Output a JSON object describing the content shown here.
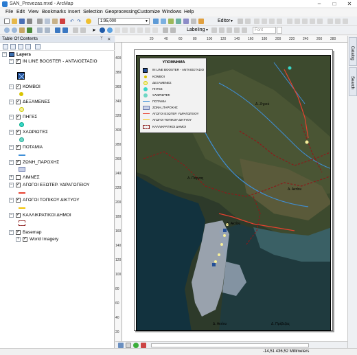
{
  "window": {
    "title": "SAN_Prevezas.mxd - ArcMap"
  },
  "menu": [
    "File",
    "Edit",
    "View",
    "Bookmarks",
    "Insert",
    "Selection",
    "Geoprocessing",
    "Customize",
    "Windows",
    "Help"
  ],
  "toolbar": {
    "scale": "1:95,000",
    "editor_label": "Editor",
    "labeling_label": "Labeling",
    "font_name": "Font"
  },
  "toc": {
    "title": "Table Of Contents",
    "root": "Layers",
    "layers": [
      {
        "label": "IN LINE BOOSTER - ΑΝΤΛΙΟΣΤΑΣΙΟ",
        "checked": true
      },
      {
        "label": "ΚΟΜΒΟΙ",
        "checked": true
      },
      {
        "label": "ΔΕΞΑΜΕΝΕΣ",
        "checked": true
      },
      {
        "label": "ΠΗΓΕΣ",
        "checked": true
      },
      {
        "label": "ΧΛΩΡΙΩΤΕΣ",
        "checked": true
      },
      {
        "label": "ΠΟΤΑΜΙΑ",
        "checked": true
      },
      {
        "label": "ΖΩΝΗ_ΠΑΡΟΧΗΣ",
        "checked": true
      },
      {
        "label": "ΛΙΜΝΕΣ",
        "checked": false
      },
      {
        "label": "ΑΓΩΓΟΙ ΕΞΩΤΕΡ. ΥΔΡΑΓΩΓΕΙΟΥ",
        "checked": true
      },
      {
        "label": "ΑΓΩΓΟΙ ΤΟΠΙΚΟΥ ΔΙΚΤΥΟΥ",
        "checked": true
      },
      {
        "label": "ΚΑΛΛΙΚΡΑΤΙΚΟΙ ΔΗΜΟΙ",
        "checked": true
      },
      {
        "label": "Basemap",
        "checked": true
      },
      {
        "label": "World Imagery",
        "checked": true
      }
    ]
  },
  "ruler": {
    "top_ticks": [
      "20",
      "40",
      "60",
      "80",
      "100",
      "120",
      "140",
      "160",
      "180",
      "200",
      "220",
      "240",
      "260",
      "280"
    ],
    "left_ticks": [
      "400",
      "380",
      "360",
      "340",
      "320",
      "300",
      "280",
      "260",
      "240",
      "220",
      "200",
      "180",
      "160",
      "140",
      "120",
      "100",
      "80",
      "60",
      "40",
      "20"
    ]
  },
  "legend": {
    "title": "ΥΠΟΜΝΗΜΑ",
    "items": [
      "IN LINE BOOSTER - ΑΝΤΛΙΟΣΤΑΣΙΟ",
      "ΚΟΜΒΟΙ",
      "ΔΕΞΑΜΕΝΕΣ",
      "ΠΗΓΕΣ",
      "ΧΛΩΡΙΩΤΕΣ",
      "ΠΟΤΑΜΙΑ",
      "ΖΩΝΗ_ΠΑΡΟΧΗΣ",
      "ΑΓΩΓΟΙ ΕΞΩΤΕΡ. ΥΔΡΑΓΩΓΕΙΟΥ",
      "ΑΓΩΓΟΙ ΤΟΠΙΚΟΥ ΔΙΚΤΥΟΥ",
      "ΚΑΛΛΙΚΡΑΤΙΚΟΙ ΔΗΜΟΙ"
    ]
  },
  "map_labels": {
    "zirou": "Δ. Ζηρού",
    "parga": "Δ. Πάργας",
    "aktiou1": "Δ. Ακτίου",
    "aktiou2": "Δ. Ακτίου",
    "aktiou3": "Δ. Ακτίου",
    "prevezas": "Δ. Πρέβεζας"
  },
  "side_tabs": [
    "Catalog",
    "Search"
  ],
  "status": {
    "coords": "-14,51 436,52 Millimeters"
  },
  "colors": {
    "toc_header": "#dfe5ee",
    "river": "#3f8fd8",
    "external_pipe": "#e8412f",
    "local_pipe": "#f2c200",
    "municipality": "#8b1a1a",
    "service_zone": "#c7cfe6"
  }
}
